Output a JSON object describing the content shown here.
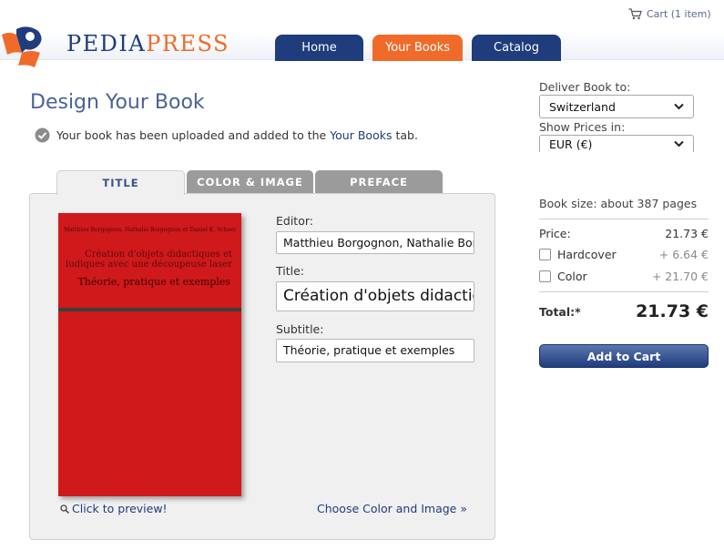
{
  "header": {
    "logo": {
      "part1": "PEDIA",
      "part2": "PRESS"
    },
    "cart_label": "Cart (1 item)",
    "nav": {
      "home": "Home",
      "your_books": "Your Books",
      "catalog": "Catalog"
    }
  },
  "main": {
    "title": "Design Your Book",
    "notice": {
      "before": "Your book has been uploaded and added to the ",
      "link": "Your Books",
      "after": " tab."
    },
    "tabs": {
      "title": "TITLE",
      "color_image": "COLOR & IMAGE",
      "preface": "PREFACE"
    },
    "cover": {
      "authors": "Matthieu Borgognon, Nathalie Borgognon et Daniel K. Schneider",
      "title": "Création d'objets didactiques et ludiques avec une découpeuse laser",
      "subtitle": "Théorie, pratique et exemples"
    },
    "preview_link": "Click to preview!",
    "choose_link": "Choose Color and Image »",
    "form": {
      "editor_label": "Editor:",
      "editor_value": "Matthieu Borgognon, Nathalie Borgognon et Daniel K. Schneider",
      "title_label": "Title:",
      "title_value": "Création d'objets didactiques et ludiques avec une découpeuse laser",
      "subtitle_label": "Subtitle:",
      "subtitle_value": "Théorie, pratique et exemples"
    }
  },
  "sidebar": {
    "deliver_label": "Deliver Book to:",
    "country": "Switzerland",
    "prices_label": "Show Prices in:",
    "currency": "EUR (€)",
    "book_size": "Book size: about 387 pages",
    "price_label": "Price:",
    "price_value": "21.73 €",
    "hardcover_label": "Hardcover",
    "hardcover_value": "+ 6.64 €",
    "color_label": "Color",
    "color_value": "+ 21.70 €",
    "total_label": "Total:*",
    "total_value": "21.73 €",
    "add_to_cart": "Add to Cart"
  },
  "colors": {
    "brand_blue": "#1f3c7c",
    "brand_orange": "#f06b2a",
    "cover_red": "#d0191b"
  }
}
